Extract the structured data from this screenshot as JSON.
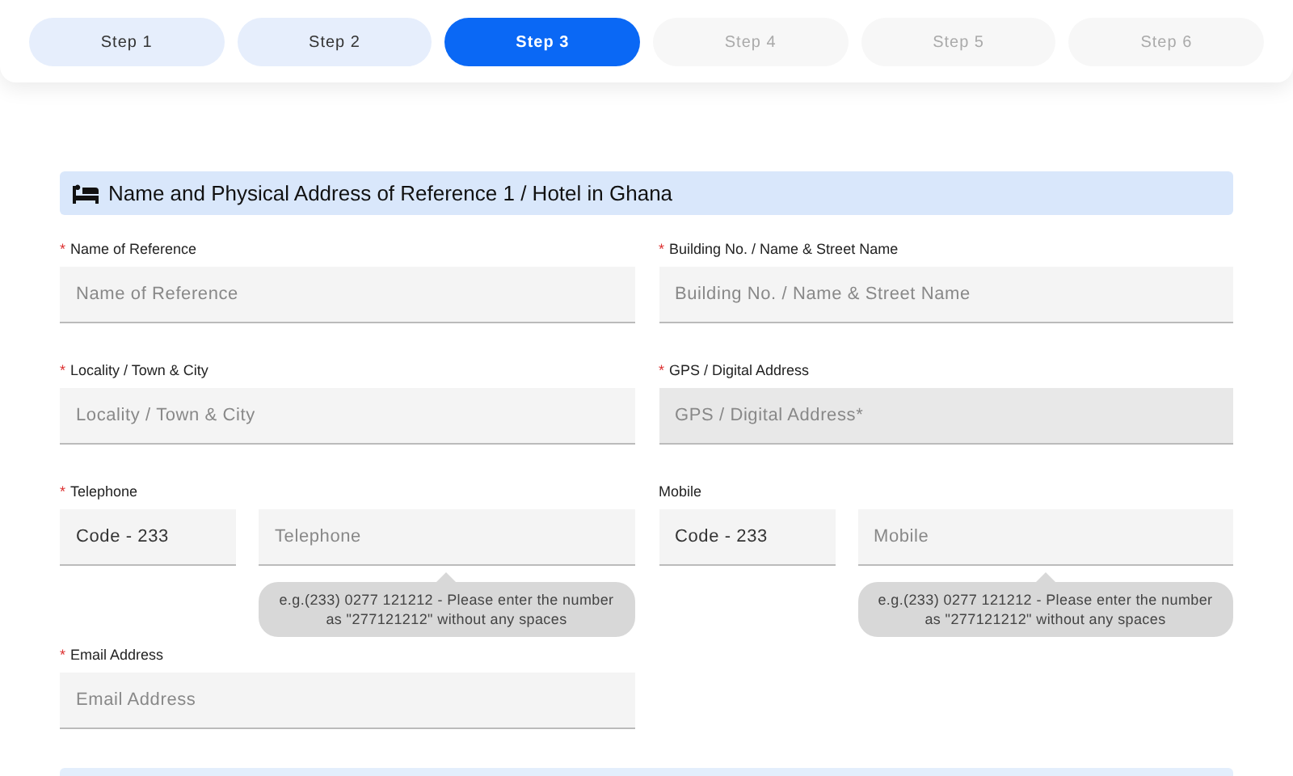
{
  "steps": [
    {
      "label": "Step 1",
      "selected": false,
      "completed": true
    },
    {
      "label": "Step 2",
      "selected": false,
      "completed": true
    },
    {
      "label": "Step 3",
      "selected": true,
      "completed": false
    },
    {
      "label": "Step 4",
      "selected": false,
      "completed": false
    },
    {
      "label": "Step 5",
      "selected": false,
      "completed": false
    },
    {
      "label": "Step 6",
      "selected": false,
      "completed": false
    }
  ],
  "section": {
    "title": "Name and Physical Address of Reference 1 / Hotel in Ghana",
    "fields": [
      {
        "kind": "text",
        "label": "Name of Reference",
        "required_mark": "*",
        "placeholder": "Name of Reference",
        "disabled": false
      },
      {
        "kind": "text",
        "label": "Building No. / Name & Street Name",
        "required_mark": "*",
        "placeholder": "Building No. / Name & Street Name",
        "disabled": false
      },
      {
        "kind": "text",
        "label": "Locality / Town & City",
        "required_mark": "*",
        "placeholder": "Locality / Town & City",
        "disabled": false
      },
      {
        "kind": "text",
        "label": "GPS / Digital Address",
        "required_mark": "*",
        "placeholder": "GPS / Digital Address*",
        "disabled": true
      },
      {
        "kind": "phone",
        "label": "Telephone",
        "required_mark": "*",
        "code": "Code - 233",
        "placeholder": "Telephone",
        "hint": "e.g.(233) 0277 121212 - Please enter the number as \"277121212\" without any spaces"
      },
      {
        "kind": "phone",
        "label": "Mobile",
        "code": "Code - 233",
        "placeholder": "Mobile",
        "hint": "e.g.(233) 0277 121212 - Please enter the number as \"277121212\" without any spaces"
      },
      {
        "kind": "text",
        "label": "Email Address",
        "required_mark": "*",
        "placeholder": "Email Address",
        "disabled": false
      }
    ]
  }
}
